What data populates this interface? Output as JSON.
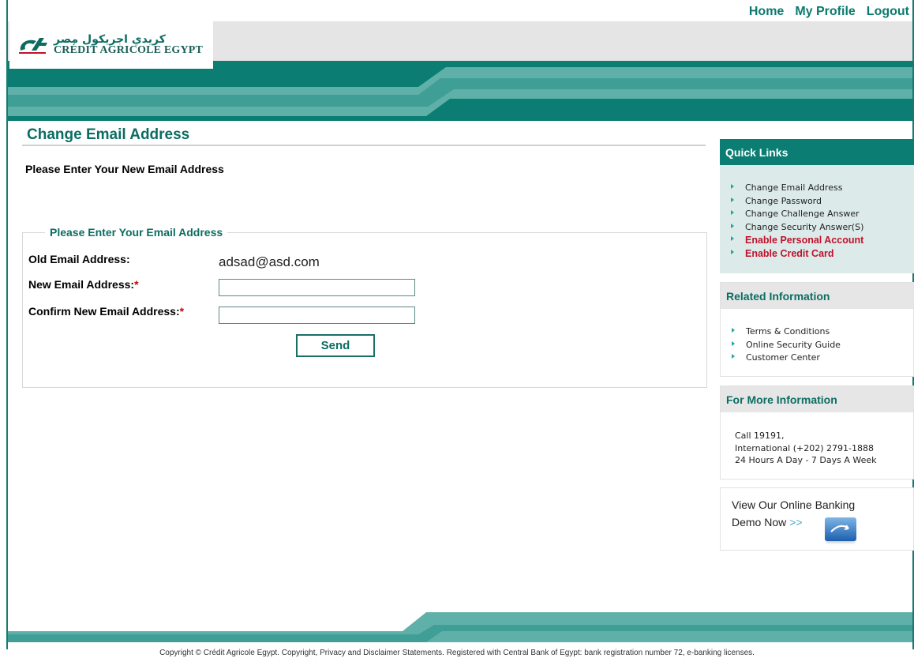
{
  "topnav": {
    "home": "Home",
    "profile": "My Profile",
    "logout": "Logout"
  },
  "logo": {
    "arabic": "كريدي اجريكول مصر",
    "english": "CRÉDIT AGRICOLE EGYPT"
  },
  "page": {
    "title": "Change Email Address",
    "subtitle": "Please Enter Your New Email Address"
  },
  "form": {
    "legend": "Please Enter Your Email Address",
    "old_label": "Old Email Address:",
    "old_value": "adsad@asd.com",
    "new_label": "New Email Address:",
    "confirm_label": "Confirm New Email Address:",
    "required_mark": "*",
    "new_value": "",
    "confirm_value": "",
    "send_label": "Send"
  },
  "sidebar": {
    "quick_links": {
      "title": "Quick Links",
      "items": [
        {
          "label": "Change Email Address"
        },
        {
          "label": "Change Password"
        },
        {
          "label": "Change Challenge Answer"
        },
        {
          "label": "Change Security Answer(S)"
        },
        {
          "label": "Enable Personal Account"
        },
        {
          "label": "Enable Credit Card"
        }
      ]
    },
    "related": {
      "title": "Related Information",
      "items": [
        {
          "label": "Terms & Conditions"
        },
        {
          "label": "Online Security Guide"
        },
        {
          "label": "Customer Center"
        }
      ]
    },
    "more": {
      "title": "For More Information",
      "line1": "Call 19191,",
      "line2": "International (+202) 2791-1888",
      "line3": "24 Hours A Day - 7 Days A Week"
    },
    "demo": {
      "line1": "View Our Online Banking",
      "line2": "Demo Now",
      "chevron": ">>"
    }
  },
  "footer": {
    "text": "Copyright © Crédit Agricole Egypt. Copyright, Privacy and Disclaimer Statements. Registered with Central Bank of Egypt: bank registration number 72, e-banking licenses."
  },
  "colors": {
    "brand_teal": "#0b7d72",
    "accent_red": "#c0112b",
    "light_panel": "#dcebea"
  }
}
